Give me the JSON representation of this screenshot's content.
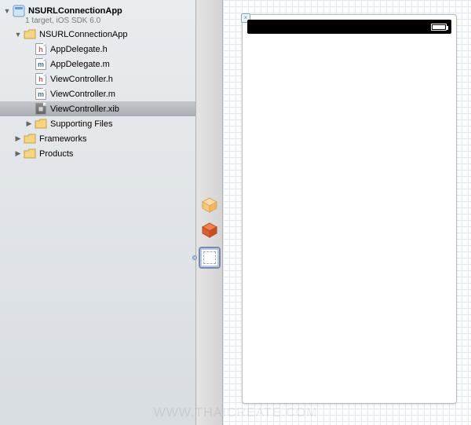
{
  "project": {
    "name": "NSURLConnectionApp",
    "subtitle": "1 target, iOS SDK 6.0"
  },
  "tree": {
    "group1": {
      "label": "NSURLConnectionApp"
    },
    "files": [
      {
        "label": "AppDelegate.h",
        "type": "h"
      },
      {
        "label": "AppDelegate.m",
        "type": "m"
      },
      {
        "label": "ViewController.h",
        "type": "h"
      },
      {
        "label": "ViewController.m",
        "type": "m"
      },
      {
        "label": "ViewController.xib",
        "type": "xib",
        "selected": true
      }
    ],
    "supporting": {
      "label": "Supporting Files"
    },
    "frameworks": {
      "label": "Frameworks"
    },
    "products": {
      "label": "Products"
    }
  },
  "watermark": "WWW.THAICREATE.COM"
}
